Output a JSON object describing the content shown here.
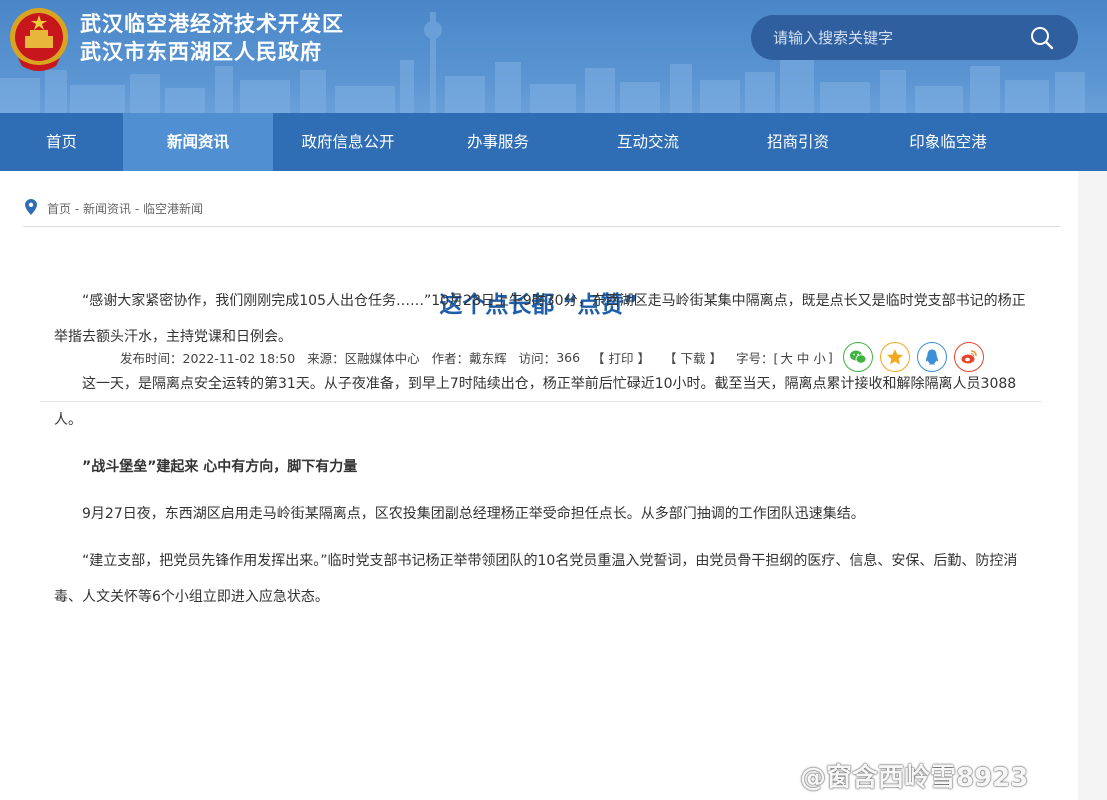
{
  "header": {
    "title_line1": "武汉临空港经济技术开发区",
    "title_line2": "武汉市东西湖区人民政府",
    "emblem_icon": "national-emblem-icon"
  },
  "search": {
    "placeholder": "请输入搜索关键字",
    "icon": "search-icon"
  },
  "nav": {
    "items": [
      "首页",
      "新闻资讯",
      "政府信息公开",
      "办事服务",
      "互动交流",
      "招商引资",
      "印象临空港"
    ],
    "active": "新闻资讯"
  },
  "breadcrumb": {
    "items": [
      "首页",
      "新闻资讯",
      "临空港新闻"
    ],
    "separator": " - "
  },
  "article": {
    "title": "这个点长都 “点赞”",
    "meta": {
      "publish": "发布时间：2022-11-02 18:50",
      "source": "来源：区融媒体中心",
      "author": "作者：戴东辉",
      "visits_label": "访问：",
      "visits": "366",
      "print": "【 打印 】",
      "download": "【 下载 】",
      "font_label": "字号：[",
      "font_large": "大",
      "font_medium": "中",
      "font_small": "小",
      "font_end": "]"
    },
    "share": [
      {
        "name": "wechat",
        "color": "#3fb33f"
      },
      {
        "name": "qzone",
        "color": "#f3a81d"
      },
      {
        "name": "qq",
        "color": "#3d8fd8"
      },
      {
        "name": "weibo",
        "color": "#e6452d"
      }
    ],
    "paragraphs": [
      "“感谢大家紧密协作，我们刚刚完成105人出仓任务……”10月28日上午9时30分，东西湖区走马岭街某集中隔离点，既是点长又是临时党支部书记的杨正举揩去额头汗水，主持党课和日例会。",
      "这一天，是隔离点安全运转的第31天。从子夜准备，到早上7时陆续出仓，杨正举前后忙碌近10小时。截至当天，隔离点累计接收和解除隔离人员3088人。",
      "”战斗堡垒”建起来 心中有方向，脚下有力量",
      "9月27日夜，东西湖区启用走马岭街某隔离点，区农投集团副总经理杨正举受命担任点长。从多部门抽调的工作团队迅速集结。",
      "“建立支部，把党员先锋作用发挥出来。”临时党支部书记杨正举带领团队的10名党员重温入党誓词，由党员骨干担纲的医疗、信息、安保、后勤、防控消毒、人文关怀等6个小组立即进入应急状态。"
    ]
  },
  "watermark": "@窗含西岭雪8923"
}
